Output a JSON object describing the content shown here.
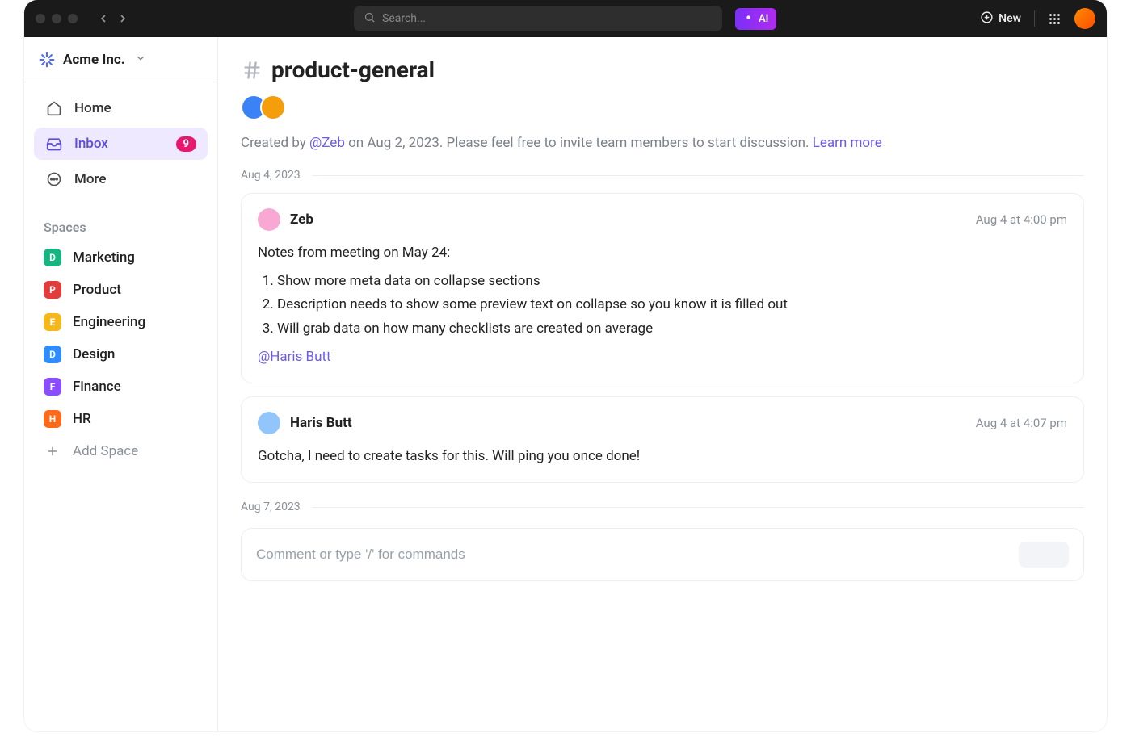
{
  "topbar": {
    "search_placeholder": "Search...",
    "ai_label": "AI",
    "new_label": "New"
  },
  "workspace": {
    "name": "Acme Inc."
  },
  "nav": {
    "home": "Home",
    "inbox": "Inbox",
    "inbox_badge": "9",
    "more": "More"
  },
  "spaces": {
    "header": "Spaces",
    "items": [
      {
        "letter": "D",
        "color": "#16b47f",
        "label": "Marketing"
      },
      {
        "letter": "P",
        "color": "#e13b3b",
        "label": "Product"
      },
      {
        "letter": "E",
        "color": "#f5b81c",
        "label": "Engineering"
      },
      {
        "letter": "D",
        "color": "#2f8cff",
        "label": "Design"
      },
      {
        "letter": "F",
        "color": "#8a4dff",
        "label": "Finance"
      },
      {
        "letter": "H",
        "color": "#ff6a1a",
        "label": "HR"
      }
    ],
    "add_label": "Add Space"
  },
  "channel": {
    "title": "product-general",
    "avatars": [
      {
        "color": "#3b82f6"
      },
      {
        "color": "#f59e0b"
      }
    ],
    "created_prefix": "Created by ",
    "created_mention": "@Zeb",
    "created_suffix": " on Aug 2, 2023. Please feel free to invite team members to start discussion. ",
    "learn_more": "Learn more"
  },
  "dates": {
    "d1": "Aug 4, 2023",
    "d2": "Aug 7, 2023"
  },
  "messages": [
    {
      "author": "Zeb",
      "avatar_color": "#f9a8d4",
      "timestamp": "Aug 4 at 4:00 pm",
      "intro": "Notes from meeting on May 24:",
      "items": [
        "Show more meta data on collapse sections",
        "Description needs to show some preview text on collapse so you know it is filled out",
        "Will grab data on how many checklists are created on average"
      ],
      "mention": "@Haris Butt"
    },
    {
      "author": "Haris Butt",
      "avatar_color": "#93c5fd",
      "timestamp": "Aug 4 at 4:07 pm",
      "text": "Gotcha, I need to create tasks for this. Will ping you once done!"
    }
  ],
  "composer": {
    "placeholder": "Comment or type '/' for commands"
  }
}
